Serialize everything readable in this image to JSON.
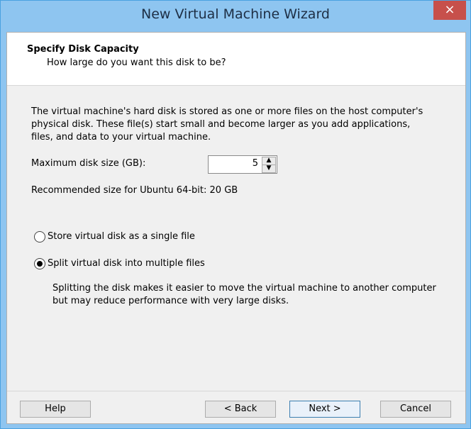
{
  "window": {
    "title": "New Virtual Machine Wizard",
    "close_glyph": "×"
  },
  "header": {
    "title": "Specify Disk Capacity",
    "subtitle": "How large do you want this disk to be?"
  },
  "description": "The virtual machine's hard disk is stored as one or more files on the host computer's physical disk. These file(s) start small and become larger as you add applications, files, and data to your virtual machine.",
  "disk_size": {
    "label": "Maximum disk size (GB):",
    "value": "5",
    "up_glyph": "▲",
    "down_glyph": "▼"
  },
  "recommended": "Recommended size for Ubuntu 64-bit: 20 GB",
  "options": [
    {
      "label": "Store virtual disk as a single file",
      "checked": false
    },
    {
      "label": "Split virtual disk into multiple files",
      "checked": true
    }
  ],
  "split_note": "Splitting the disk makes it easier to move the virtual machine to another computer but may reduce performance with very large disks.",
  "buttons": {
    "help": "Help",
    "back": "< Back",
    "next": "Next >",
    "cancel": "Cancel"
  }
}
